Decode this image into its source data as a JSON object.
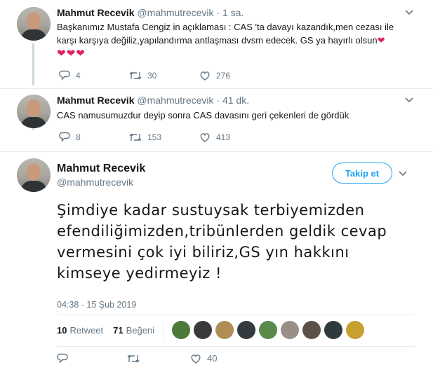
{
  "tweets": [
    {
      "name": "Mahmut Recevik",
      "handle": "@mahmutrecevik",
      "time": "· 1 sa.",
      "text_line1": "Başkanımız Mustafa Cengiz in açıklaması : CAS 'ta davayı kazandık,men cezası ile",
      "text_line2": "karşı karşıya değiliz,yapılandırma antlaşması dvsm edecek. GS ya hayırlı olsun",
      "hearts_inline": "❤",
      "hearts_line": "❤❤❤",
      "replies": "4",
      "retweets": "30",
      "likes": "276"
    },
    {
      "name": "Mahmut Recevik",
      "handle": "@mahmutrecevik",
      "time": "· 41 dk.",
      "text_line1": "CAS namusumuzdur deyip sonra CAS davasını geri çekenleri de gördük",
      "replies": "8",
      "retweets": "153",
      "likes": "413"
    }
  ],
  "main": {
    "name": "Mahmut Recevik",
    "handle": "@mahmutrecevik",
    "follow_label": "Takip et",
    "text": "Şimdiye kadar sustuysak terbiyemizden efendiliğimizden,tribünlerden geldik cevap vermesini çok iyi biliriz,GS yın hakkını kimseye yedirmeyiz !",
    "timestamp": "04:38 - 15 Şub 2019",
    "retweet_count": "10",
    "retweet_label": "Retweet",
    "like_count": "71",
    "like_label": "Beğeni",
    "bottom_partial": "40"
  },
  "colors": {
    "accent": "#1da1f2",
    "secondary_text": "#657786",
    "heart": "#e0245e",
    "thread_line": "#ccd6dd"
  },
  "likers": [
    "#4c7a3a",
    "#3a3a3a",
    "#b08d55",
    "#333a40",
    "#5a8a4a",
    "#9a8f86",
    "#5c5148",
    "#2f3a3c",
    "#c8a030"
  ]
}
